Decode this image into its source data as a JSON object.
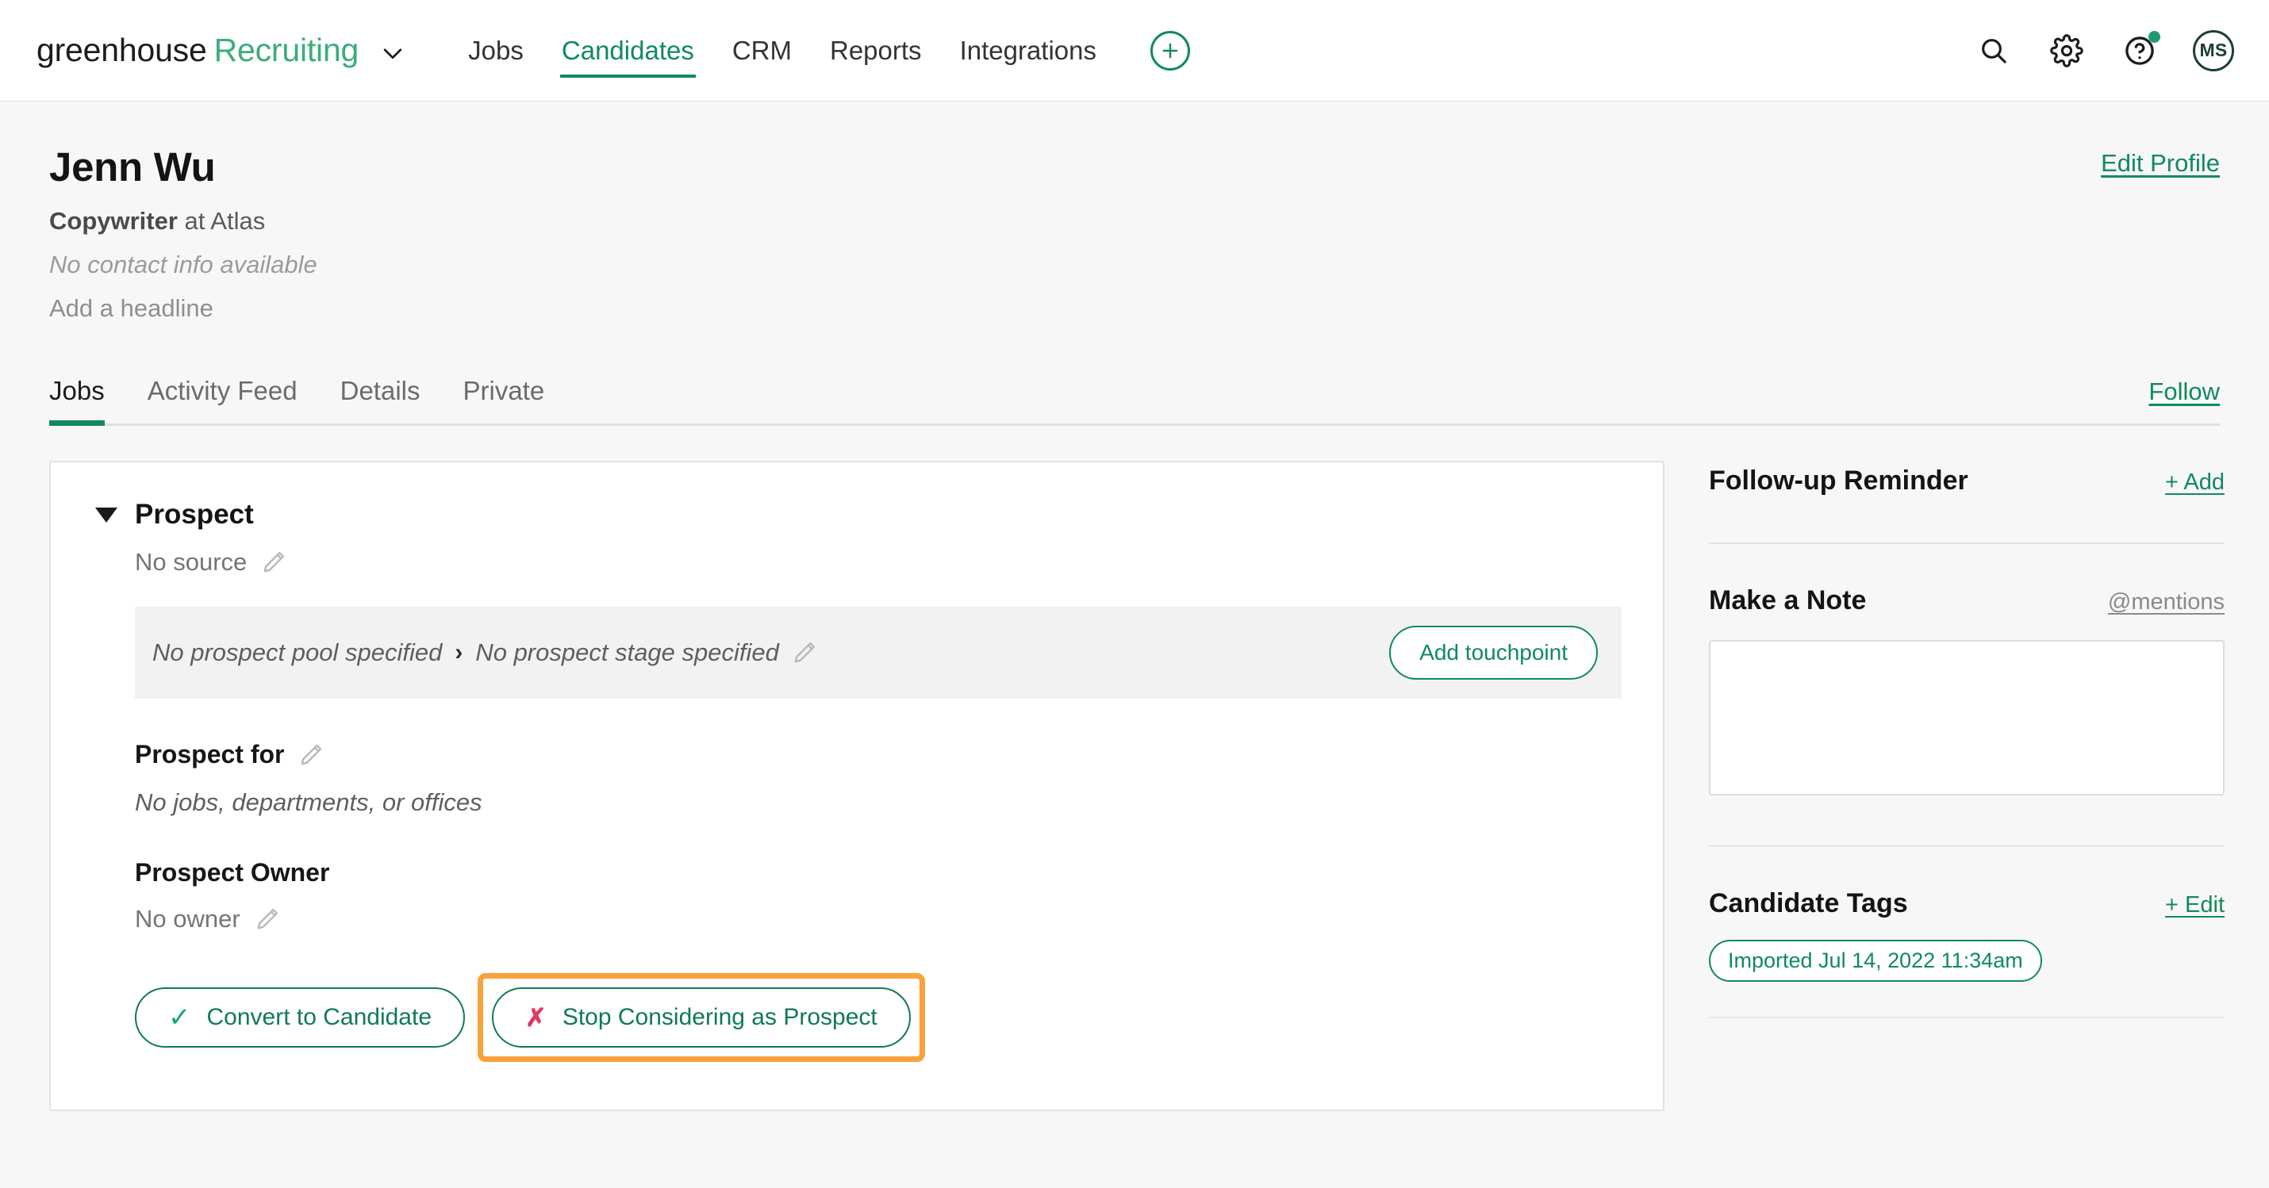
{
  "topnav": {
    "brand_primary": "greenhouse",
    "brand_secondary": "Recruiting",
    "caret_icon": "chevron-down-icon",
    "links": [
      {
        "label": "Jobs",
        "active": false
      },
      {
        "label": "Candidates",
        "active": true
      },
      {
        "label": "CRM",
        "active": false
      },
      {
        "label": "Reports",
        "active": false
      },
      {
        "label": "Integrations",
        "active": false
      }
    ],
    "add_icon": "plus-circle-icon",
    "search_icon": "search-icon",
    "settings_icon": "gear-icon",
    "help_icon": "question-circle-icon",
    "avatar_initials": "MS",
    "accent_green": "#108a5c",
    "brand_green": "#3bad7b"
  },
  "profile": {
    "name": "Jenn Wu",
    "role_title": "Copywriter",
    "role_rest": " at Atlas",
    "contact": "No contact info available",
    "headline": "Add a headline",
    "edit_profile_label": "Edit Profile"
  },
  "tabs": {
    "items": [
      {
        "label": "Jobs",
        "active": true
      },
      {
        "label": "Activity Feed",
        "active": false
      },
      {
        "label": "Details",
        "active": false
      },
      {
        "label": "Private",
        "active": false
      }
    ],
    "follow_label": "Follow"
  },
  "prospect_card": {
    "title": "Prospect",
    "disclosure_icon": "triangle-down-icon",
    "source_value": "No source",
    "source_edit_icon": "pencil-icon",
    "pool_value": "No prospect pool specified",
    "pool_separator": "›",
    "stage_value": "No prospect stage specified",
    "pool_edit_icon": "pencil-icon",
    "add_touchpoint_label": "Add touchpoint",
    "prospect_for_label": "Prospect for",
    "prospect_for_edit_icon": "pencil-icon",
    "prospect_for_value": "No jobs, departments, or offices",
    "prospect_owner_label": "Prospect Owner",
    "prospect_owner_value": "No owner",
    "prospect_owner_edit_icon": "pencil-icon",
    "convert_label": "Convert to Candidate",
    "convert_icon": "check-icon",
    "stop_label": "Stop Considering as Prospect",
    "stop_icon": "x-icon",
    "highlight_color": "#f9a13b"
  },
  "sidebar": {
    "followup_title": "Follow-up Reminder",
    "followup_add_label": "+ Add",
    "note_title": "Make a Note",
    "mentions_label": "@mentions",
    "note_value": "",
    "note_placeholder": "",
    "tags_title": "Candidate Tags",
    "tags_edit_label": "+ Edit",
    "tags": [
      "Imported Jul 14, 2022 11:34am"
    ]
  }
}
